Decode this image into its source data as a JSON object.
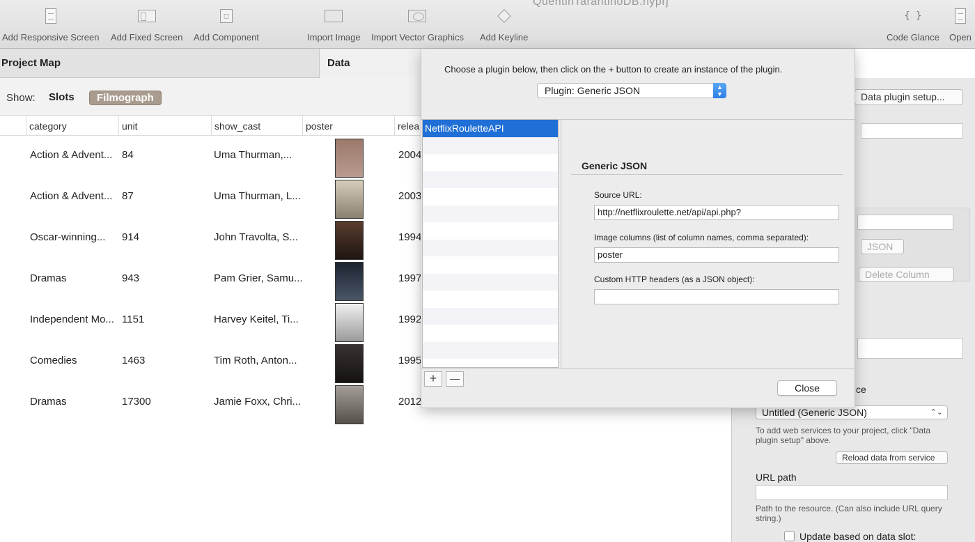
{
  "window": {
    "title": "QuentinTarantinoDB.hyprj"
  },
  "toolbar": {
    "items": [
      {
        "label": "Add Responsive Screen",
        "icon": "page-icon"
      },
      {
        "label": "Add Fixed Screen",
        "icon": "fixed-screen-icon"
      },
      {
        "label": "Add Component",
        "icon": "component-icon"
      },
      {
        "label": "Import Image",
        "icon": "image-icon"
      },
      {
        "label": "Import Vector Graphics",
        "icon": "vector-icon"
      },
      {
        "label": "Add Keyline",
        "icon": "keyline-icon"
      },
      {
        "label": "Code Glance",
        "icon": "code-glance-icon"
      },
      {
        "label": "Open",
        "icon": "open-icon"
      }
    ]
  },
  "panels": {
    "project_map": "Project Map",
    "data": "Data"
  },
  "showbar": {
    "label": "Show:",
    "slots": "Slots",
    "filmograph": "Filmograph"
  },
  "table": {
    "columns": [
      "category",
      "unit",
      "show_cast",
      "poster",
      "relea"
    ],
    "rows": [
      {
        "category": "Action & Advent...",
        "unit": "84",
        "cast": "Uma Thurman,...",
        "year": "2004",
        "poster_color": "#a8867a"
      },
      {
        "category": "Action & Advent...",
        "unit": "87",
        "cast": "Uma Thurman, L...",
        "year": "2003",
        "poster_color": "#c9bfae"
      },
      {
        "category": "Oscar-winning...",
        "unit": "914",
        "cast": "John Travolta, S...",
        "year": "1994",
        "poster_color": "#3a2a24"
      },
      {
        "category": "Dramas",
        "unit": "943",
        "cast": "Pam Grier, Samu...",
        "year": "1997",
        "poster_color": "#2a3340"
      },
      {
        "category": "Independent Mo...",
        "unit": "1151",
        "cast": "Harvey Keitel, Ti...",
        "year": "1992",
        "poster_color": "#dcdcdc"
      },
      {
        "category": "Comedies",
        "unit": "1463",
        "cast": "Tim Roth, Anton...",
        "year": "1995",
        "poster_color": "#2b2626"
      },
      {
        "category": "Dramas",
        "unit": "17300",
        "cast": "Jamie Foxx, Chri...",
        "year": "2012",
        "poster_color": "#8a8580"
      }
    ]
  },
  "inspector": {
    "data_plugin_setup": "Data plugin setup...",
    "json_button": "JSON",
    "delete_column": "Delete Column",
    "section_suffix": "ce",
    "service_select": "Untitled (Generic JSON)",
    "help_text": "To add web services to your project, click \"Data plugin setup\" above.",
    "reload_button": "Reload data from service",
    "url_path_label": "URL path",
    "url_path_help": "Path to the resource. (Can also include URL query string.)",
    "update_checkbox_label": "Update based on data slot:"
  },
  "sheet": {
    "instruction": "Choose a plugin below, then click on the + button to create an instance of the plugin.",
    "plugin_select": "Plugin: Generic JSON",
    "plugins": [
      "NetflixRouletteAPI"
    ],
    "detail_title": "Generic JSON",
    "source_url_label": "Source URL:",
    "source_url_value": "http://netflixroulette.net/api/api.php?",
    "image_columns_label": "Image columns (list of column names, comma separated):",
    "image_columns_value": "poster",
    "headers_label": "Custom HTTP headers (as a JSON object):",
    "headers_value": "",
    "add_symbol": "+",
    "remove_symbol": "—",
    "close_button": "Close"
  },
  "colors": {
    "selection": "#1f6fd6",
    "filmograph_badge": "#a99b8e",
    "stepper": "#2d7fe6"
  }
}
